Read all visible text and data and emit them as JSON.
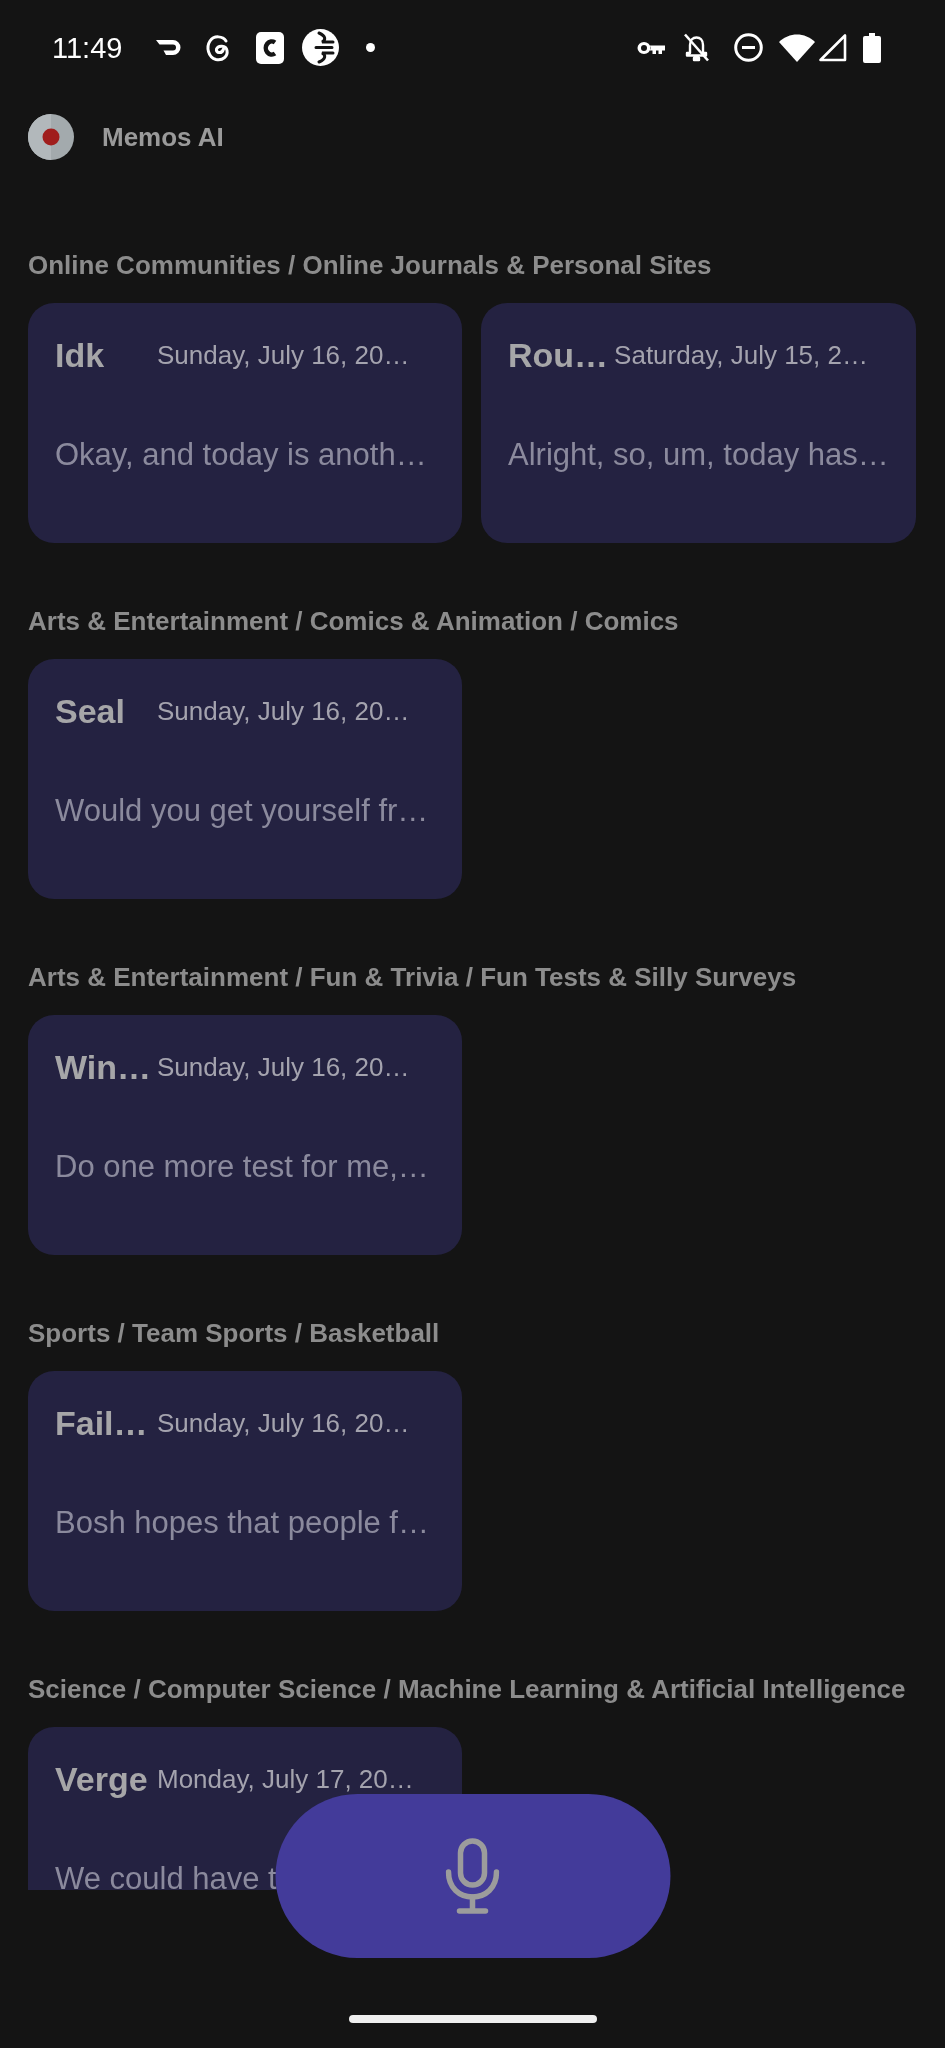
{
  "status_bar": {
    "time": "11:49"
  },
  "app_bar": {
    "title": "Memos AI"
  },
  "sections": [
    {
      "category": "Online Communities / Online Journals & Personal Sites",
      "memos": [
        {
          "title": "Idk",
          "date": "Sunday, July 16, 20…",
          "preview": "Okay, and today is anoth…"
        },
        {
          "title": "Rou…",
          "date": "Saturday, July 15, 2…",
          "preview": "Alright, so, um, today has…"
        }
      ]
    },
    {
      "category": "Arts & Entertainment / Comics & Animation / Comics",
      "memos": [
        {
          "title": "Seal",
          "date": "Sunday, July 16, 20…",
          "preview": "Would you get yourself fr…"
        }
      ]
    },
    {
      "category": "Arts & Entertainment / Fun & Trivia / Fun Tests & Silly Surveys",
      "memos": [
        {
          "title": "Win…",
          "date": "Sunday, July 16, 20…",
          "preview": "Do one more test for me,…"
        }
      ]
    },
    {
      "category": "Sports / Team Sports / Basketball",
      "memos": [
        {
          "title": "Fail…",
          "date": "Sunday, July 16, 20…",
          "preview": "Bosh hopes that people f…"
        }
      ]
    },
    {
      "category": "Science / Computer Science / Machine Learning & Artificial Intelligence",
      "memos": [
        {
          "title": "Verge",
          "date": "Monday, July 17, 20…",
          "preview": "We could have t"
        }
      ]
    }
  ]
}
